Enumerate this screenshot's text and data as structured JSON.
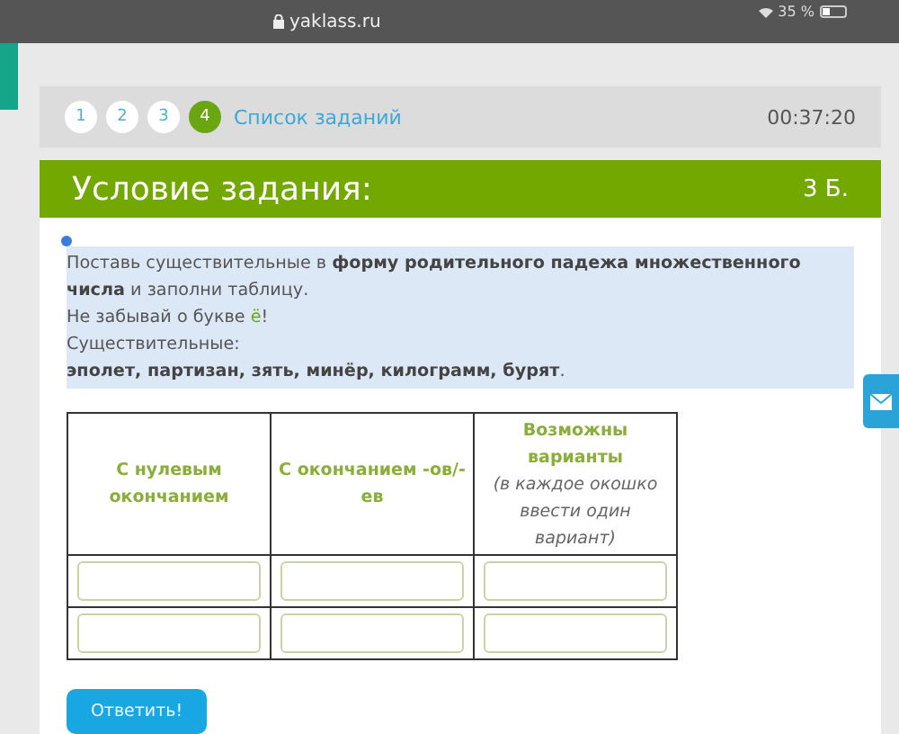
{
  "status_bar": {
    "url": "yaklass.ru",
    "battery": "35 %"
  },
  "nav": {
    "steps": [
      {
        "label": "1",
        "selected": false
      },
      {
        "label": "2",
        "selected": false
      },
      {
        "label": "3",
        "selected": false
      },
      {
        "label": "4",
        "selected": true
      }
    ],
    "task_list_link": "Список заданий",
    "timer": "00:37:20"
  },
  "task": {
    "title": "Условие задания:",
    "points": "3 Б.",
    "instruction": [
      {
        "text": "Поставь существительные в **форму родительного падежа множественного числа** и заполни таблицу."
      },
      {
        "text": "Не забывай о букве ",
        "accent": "ё",
        "after": "!"
      },
      {
        "text": "Существительные:"
      },
      {
        "text": "**эполет, партизан, зять, минёр, килограмм, бурят**."
      }
    ],
    "table": {
      "columns": [
        {
          "title": "С нулевым окончанием"
        },
        {
          "title": "С окончанием -ов/-ев"
        },
        {
          "title": "Возможны варианты",
          "note": "(в каждое окошко ввести один вариант)"
        }
      ],
      "rows": [
        {
          "fields": [
            {
              "kind": "input"
            },
            {
              "kind": "input"
            },
            {
              "kind": "input"
            }
          ]
        },
        {
          "fields": [
            {
              "kind": "input"
            },
            {
              "kind": "input"
            },
            {
              "kind": "input"
            }
          ]
        }
      ]
    },
    "submit": "Ответить!"
  }
}
